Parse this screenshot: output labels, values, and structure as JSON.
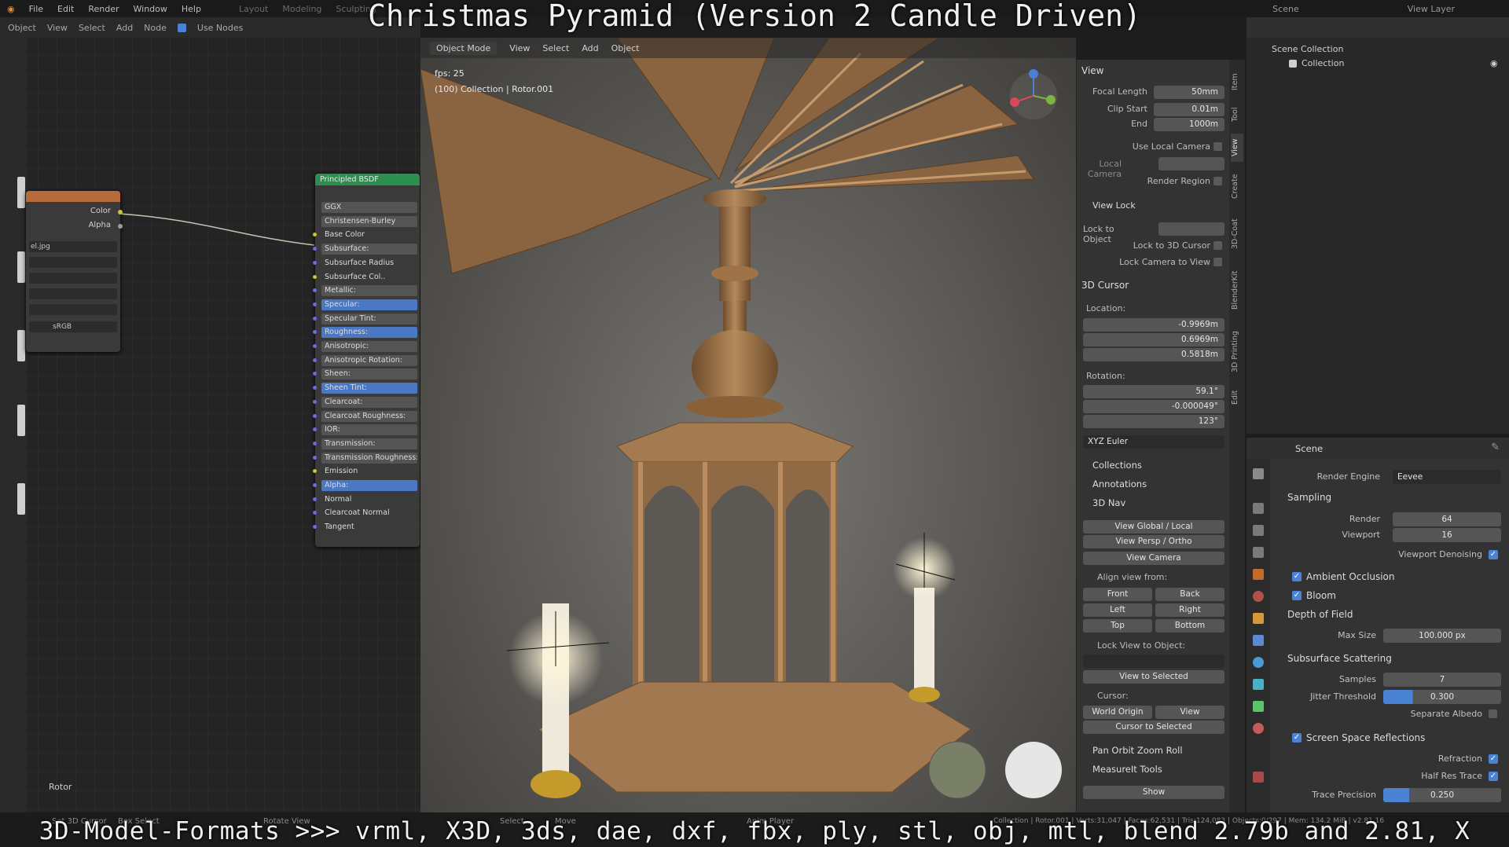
{
  "overlay": {
    "title": "Christmas Pyramid (Version 2 Candle Driven)",
    "bottom_caption": "3D-Model-Formats >>> vrml, X3D, 3ds, dae, dxf, fbx, ply, stl, obj, mtl, blend 2.79b and 2.81, X"
  },
  "menubar": {
    "items": [
      "File",
      "Edit",
      "Render",
      "Window",
      "Help"
    ],
    "workspaces": [
      "Layout",
      "Modeling",
      "Sculpting"
    ],
    "scene_label": "Scene",
    "view_layer_label": "View Layer"
  },
  "node_editor": {
    "header": [
      "Object",
      "View",
      "Select",
      "Add",
      "Node",
      "Use Nodes"
    ],
    "image_node": {
      "outputs": [
        "Color",
        "Alpha"
      ],
      "file": "el.jpg",
      "colorspace": "sRGB"
    },
    "bsdf": {
      "title": "Principled BSDF",
      "rows": [
        {
          "label": "GGX",
          "style": "field"
        },
        {
          "label": "Christensen-Burley",
          "style": "field"
        },
        {
          "label": "Base Color",
          "style": "plain"
        },
        {
          "label": "Subsurface:",
          "style": "field"
        },
        {
          "label": "Subsurface Radius",
          "style": "plain"
        },
        {
          "label": "Subsurface Col..",
          "style": "plain"
        },
        {
          "label": "Metallic:",
          "style": "field"
        },
        {
          "label": "Specular:",
          "style": "hl"
        },
        {
          "label": "Specular Tint:",
          "style": "field"
        },
        {
          "label": "Roughness:",
          "style": "hl"
        },
        {
          "label": "Anisotropic:",
          "style": "field"
        },
        {
          "label": "Anisotropic Rotation:",
          "style": "field"
        },
        {
          "label": "Sheen:",
          "style": "field"
        },
        {
          "label": "Sheen Tint:",
          "style": "hl"
        },
        {
          "label": "Clearcoat:",
          "style": "field"
        },
        {
          "label": "Clearcoat Roughness:",
          "style": "field"
        },
        {
          "label": "IOR:",
          "style": "field"
        },
        {
          "label": "Transmission:",
          "style": "field"
        },
        {
          "label": "Transmission Roughness:",
          "style": "field"
        },
        {
          "label": "Emission",
          "style": "plain"
        },
        {
          "label": "Alpha:",
          "style": "hl"
        },
        {
          "label": "Normal",
          "style": "plain"
        },
        {
          "label": "Clearcoat Normal",
          "style": "plain"
        },
        {
          "label": "Tangent",
          "style": "plain"
        }
      ]
    },
    "frame_label": "Rotor"
  },
  "viewport": {
    "header": [
      "Object Mode",
      "View",
      "Select",
      "Add",
      "Object"
    ],
    "fps": "fps: 25",
    "info": "(100) Collection | Rotor.001"
  },
  "npanel": {
    "view_section": "View",
    "focal_length_label": "Focal Length",
    "focal_length": "50mm",
    "clip_start_label": "Clip Start",
    "clip_start": "0.01m",
    "clip_end_label": "End",
    "clip_end": "1000m",
    "use_local_camera": "Use Local Camera",
    "local_camera": "Local Camera",
    "render_region": "Render Region",
    "view_lock": "View Lock",
    "lock_to_object": "Lock to Object",
    "lock_3d_cursor": "Lock to 3D Cursor",
    "lock_camera": "Lock Camera to View",
    "cursor_section": "3D Cursor",
    "location_label": "Location:",
    "loc": {
      "x": "-0.9969m",
      "y": "0.6969m",
      "z": "0.5818m"
    },
    "rotation_label": "Rotation:",
    "rot": {
      "x": "59.1°",
      "y": "-0.000049°",
      "z": "123°"
    },
    "euler": "XYZ Euler",
    "collections": "Collections",
    "annotations": "Annotations",
    "nav": "3D Nav",
    "view_global": "View Global / Local",
    "view_persp": "View Persp / Ortho",
    "view_camera": "View Camera",
    "align_view": "Align view from:",
    "front": "Front",
    "back": "Back",
    "left": "Left",
    "right": "Right",
    "top": "Top",
    "bottom": "Bottom",
    "lock_view": "Lock View to Object:",
    "view_selected": "View to Selected",
    "cursor_label": "Cursor:",
    "world_origin": "World Origin",
    "view": "View",
    "cursor_to_selected": "Cursor to Selected",
    "pan_orbit": "Pan Orbit Zoom Roll",
    "measureit": "MeasureIt Tools",
    "show": "Show",
    "tabs": [
      "Item",
      "Tool",
      "View",
      "Create",
      "3D-Coat",
      "BlenderKit",
      "3D Printing",
      "Edit"
    ]
  },
  "outliner": {
    "scene_collection": "Scene Collection",
    "collection": "Collection"
  },
  "properties": {
    "scene": "Scene",
    "render_engine_label": "Render Engine",
    "render_engine": "Eevee",
    "sampling": "Sampling",
    "render_label": "Render",
    "render_samples": "64",
    "viewport_label": "Viewport",
    "viewport_samples": "16",
    "viewport_denoising": "Viewport Denoising",
    "ambient_occlusion": "Ambient Occlusion",
    "bloom": "Bloom",
    "depth_of_field": "Depth of Field",
    "max_size_label": "Max Size",
    "max_size": "100.000 px",
    "sss": "Subsurface Scattering",
    "samples_label": "Samples",
    "samples": "7",
    "jitter_label": "Jitter Threshold",
    "jitter": "0.300",
    "separate_albedo": "Separate Albedo",
    "ssr": "Screen Space Reflections",
    "refraction": "Refraction",
    "half_res": "Half Res Trace",
    "trace_precision_label": "Trace Precision",
    "trace_precision": "0.250"
  },
  "statusbar": {
    "left": "Set 3D Cursor",
    "middle": "Box Select",
    "rotate": "Rotate View",
    "select": "Select",
    "move": "Move",
    "anim": "Anim Player",
    "stats": "Collection | Rotor.001 | Verts:31,047 | Faces:62,531 | Tris:124,083 | Objects:0/297 | Mem: 134.2 MiB | v2.81.16"
  },
  "colors": {
    "accent_blue": "#4a83d4",
    "bsdf_header": "#2d8f4e",
    "texture_header": "#b86b3a",
    "wood": "#a57a4e"
  }
}
